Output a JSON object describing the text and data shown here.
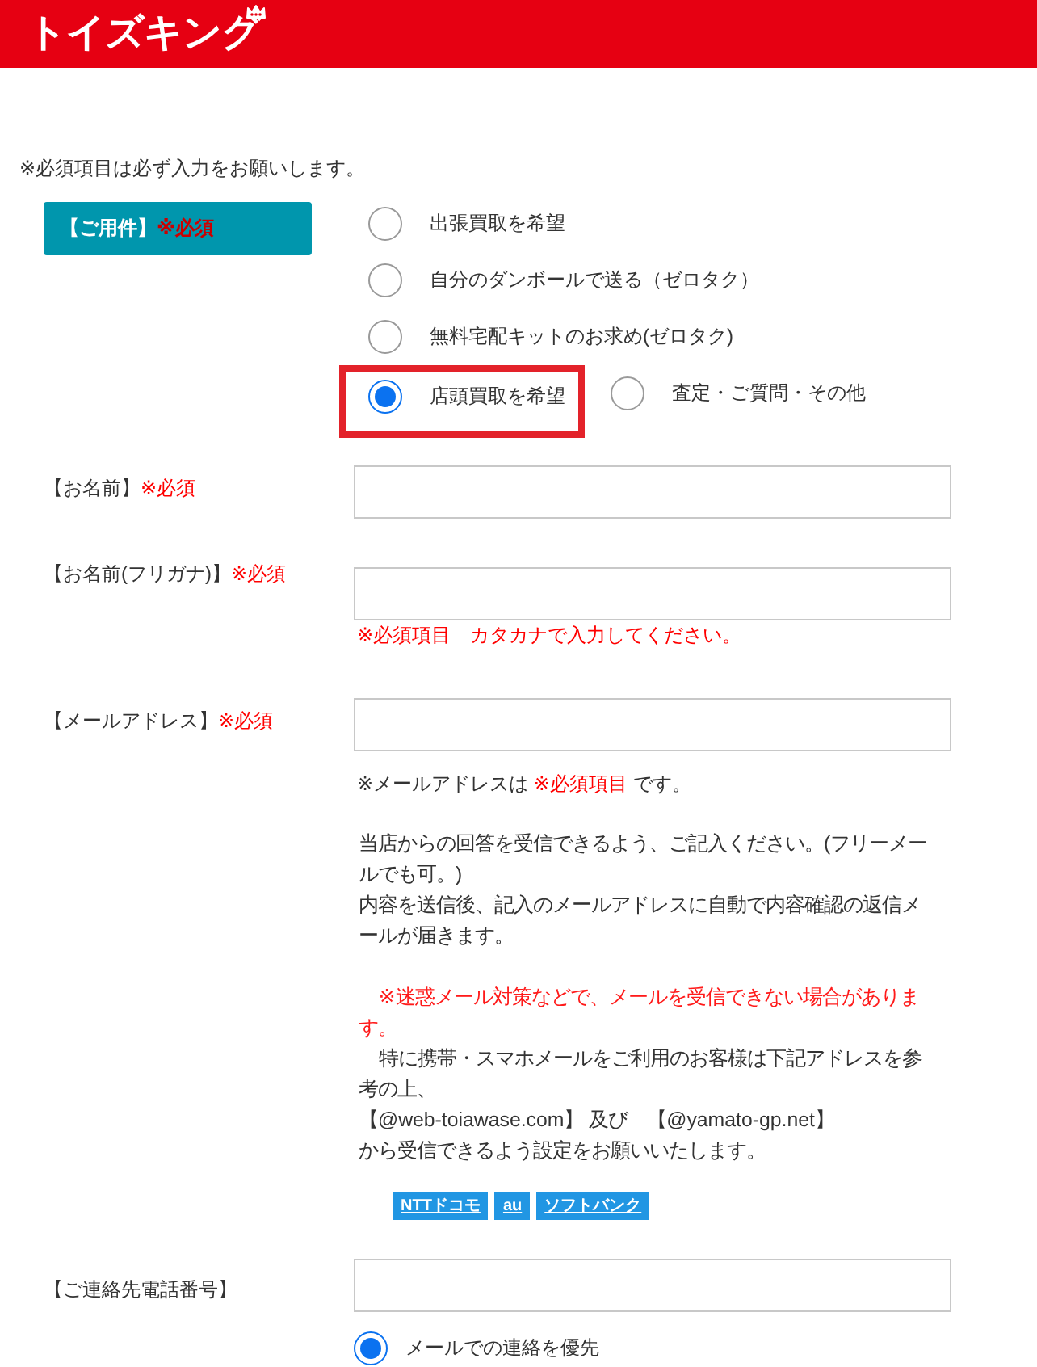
{
  "header": {
    "logo": "トイズキング"
  },
  "notice": "※必須項目は必ず入力をお願いします。",
  "purpose": {
    "label": "【ご用件】",
    "required": "※必須",
    "option_rows": [
      [
        {
          "label": "出張買取を希望",
          "selected": false,
          "highlighted": false
        }
      ],
      [
        {
          "label": "自分のダンボールで送る（ゼロタク）",
          "selected": false,
          "highlighted": false
        }
      ],
      [
        {
          "label": "無料宅配キットのお求め(ゼロタク)",
          "selected": false,
          "highlighted": false
        }
      ],
      [
        {
          "label": "店頭買取を希望",
          "selected": true,
          "highlighted": true
        },
        {
          "label": "査定・ご質問・その他",
          "selected": false,
          "highlighted": false
        }
      ]
    ]
  },
  "fields": [
    {
      "label": "【お名前】",
      "required": "※必須"
    },
    {
      "label": "【お名前(フリガナ)】",
      "required": "※必須",
      "hint": "※必須項目　カタカナで入力してください。"
    },
    {
      "label": "【メールアドレス】",
      "required": "※必須",
      "note": [
        {
          "text": "※メールアドレスは ",
          "kind": "plain"
        },
        {
          "text": "※必須項目",
          "kind": "required"
        },
        {
          "text": " です。",
          "kind": "plain"
        }
      ],
      "paragraphs": [
        {
          "text": "当店からの回答を受信できるよう、ご記入ください。(フリーメールでも可。)",
          "kind": "plain"
        },
        {
          "text": "内容を送信後、記入のメールアドレスに自動で内容確認の返信メールが届きます。",
          "kind": "plain"
        },
        {
          "text": "※迷惑メール対策などで、メールを受信できない場合があります。",
          "kind": "warning"
        },
        {
          "text": "特に携帯・スマホメールをご利用のお客様は下記アドレスを参考の上、",
          "kind": "indented"
        },
        {
          "text": "【@web-toiawase.com】 及び　【@yamato-gp.net】",
          "kind": "plain"
        },
        {
          "text": "から受信できるよう設定をお願いいたします。",
          "kind": "plain"
        }
      ],
      "links": [
        "NTTドコモ",
        "au",
        "ソフトバンク"
      ]
    },
    {
      "label": "【ご連絡先電話番号】",
      "contact_options": [
        {
          "label": "メールでの連絡を優先",
          "selected": true
        }
      ]
    }
  ]
}
